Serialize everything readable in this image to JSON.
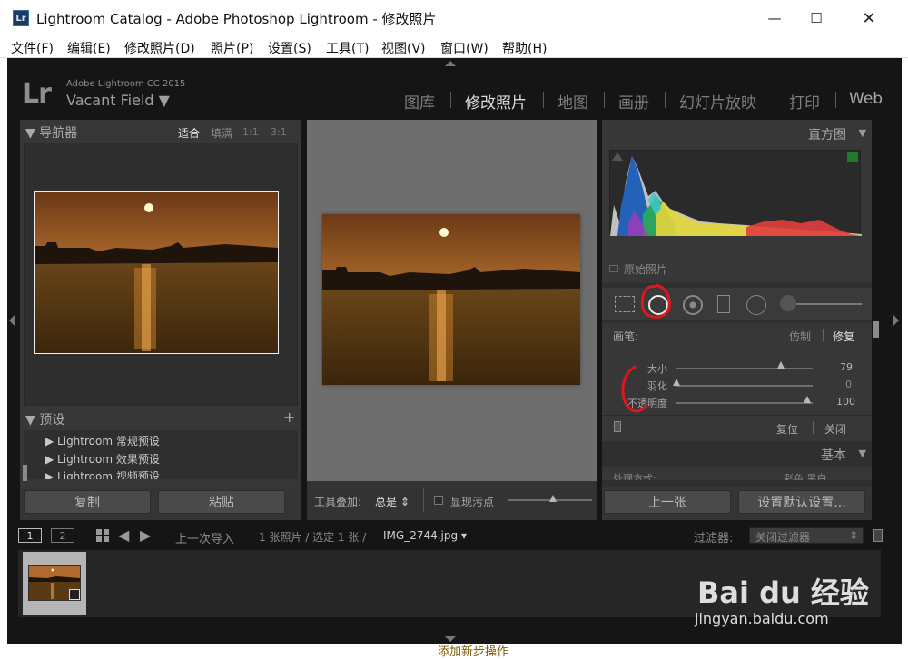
{
  "window": {
    "title": "Lightroom Catalog - Adobe Photoshop Lightroom - 修改照片",
    "app_icon": "Lr"
  },
  "menu": [
    "文件(F)",
    "编辑(E)",
    "修改照片(D)",
    "照片(P)",
    "设置(S)",
    "工具(T)",
    "视图(V)",
    "窗口(W)",
    "帮助(H)"
  ],
  "identity": {
    "logo": "Lr",
    "product": "Adobe Lightroom CC 2015",
    "catalog_name": "Vacant Field"
  },
  "modules": [
    "图库",
    "修改照片",
    "地图",
    "画册",
    "幻灯片放映",
    "打印",
    "Web"
  ],
  "active_module": "修改照片",
  "navigator": {
    "title": "导航器",
    "zoom": [
      "适合",
      "填满",
      "1:1",
      "3:1"
    ],
    "active_zoom": "适合"
  },
  "presets": {
    "title": "预设",
    "items": [
      "Lightroom 常规预设",
      "Lightroom 效果预设",
      "Lightroom 视频预设"
    ]
  },
  "left_buttons": {
    "copy": "复制",
    "paste": "粘贴"
  },
  "toolbar": {
    "overlay_label": "工具叠加:",
    "overlay_value": "总是",
    "spot_label": "显现污点"
  },
  "histogram": {
    "title": "直方图",
    "original": "原始照片"
  },
  "brush": {
    "label": "画笔:",
    "modes": [
      "仿制",
      "修复"
    ],
    "active_mode": "修复",
    "sliders": [
      {
        "label": "大小",
        "value": "79",
        "level": 0.79
      },
      {
        "label": "羽化",
        "value": "0",
        "level": 0.0
      },
      {
        "label": "不透明度",
        "value": "100",
        "level": 1.0
      }
    ],
    "reset": "复位",
    "close": "关闭"
  },
  "basic": {
    "title": "基本",
    "cutoff_left": "处理方式:",
    "cutoff_right": "彩色  黑白"
  },
  "right_buttons": {
    "previous": "上一张",
    "defaults": "设置默认设置..."
  },
  "filmstrip": {
    "views": [
      "1",
      "2"
    ],
    "source": "上一次导入",
    "info": "1 张照片 / 选定 1 张 /",
    "file": "IMG_2744.jpg",
    "filter_label": "过滤器:",
    "filter_value": "关闭过滤器"
  },
  "watermark": {
    "brand": "Bai du 经验",
    "url": "jingyan.baidu.com",
    "caption": "添加新步操作"
  },
  "colors": {
    "accent_annotation": "#e0161b",
    "bg": "#151515",
    "panel": "#373737"
  }
}
